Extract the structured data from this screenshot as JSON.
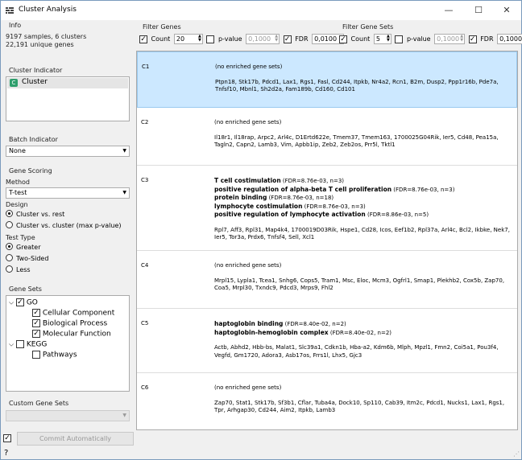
{
  "window": {
    "title": "Cluster Analysis",
    "minimize": "—",
    "maximize": "☐",
    "close": "✕"
  },
  "info": {
    "label": "Info",
    "line1": "9197 samples, 6 clusters",
    "line2": "22,191 unique genes"
  },
  "cluster_indicator": {
    "label": "Cluster Indicator",
    "item": "Cluster",
    "icon_letter": "C"
  },
  "batch_indicator": {
    "label": "Batch Indicator",
    "value": "None"
  },
  "gene_scoring": {
    "label": "Gene Scoring",
    "method_label": "Method",
    "method_value": "T-test",
    "design_label": "Design",
    "design_options": [
      "Cluster vs. rest",
      "Cluster vs. cluster (max p-value)"
    ],
    "test_type_label": "Test Type",
    "test_options": [
      "Greater",
      "Two-Sided",
      "Less"
    ]
  },
  "gene_sets": {
    "label": "Gene Sets",
    "go": "GO",
    "go_children": [
      "Cellular Component",
      "Biological Process",
      "Molecular Function"
    ],
    "kegg": "KEGG",
    "kegg_children": [
      "Pathways"
    ]
  },
  "custom_gene_sets": {
    "label": "Custom Gene Sets"
  },
  "commit": {
    "label": "Commit Automatically"
  },
  "filter_genes": {
    "label": "Filter Genes",
    "count_label": "Count",
    "count_value": "20",
    "pvalue_label": "p-value",
    "pvalue_value": "0,1000",
    "fdr_label": "FDR",
    "fdr_value": "0,0100"
  },
  "filter_gene_sets": {
    "label": "Filter Gene Sets",
    "count_label": "Count",
    "count_value": "5",
    "pvalue_label": "p-value",
    "pvalue_value": "0,1000",
    "fdr_label": "FDR",
    "fdr_value": "0,1000"
  },
  "clusters": [
    {
      "id": "C1",
      "no_enriched": "(no enriched gene sets)",
      "genes": "Ptpn18, Stk17b, Pdcd1, Lax1, Rgs1, Fasl, Cd244, Itpkb, Nr4a2, Rcn1, B2m, Dusp2, Ppp1r16b, Pde7a, Tnfsf10, Mbnl1, Sh2d2a, Fam189b, Cd160, Cd101"
    },
    {
      "id": "C2",
      "no_enriched": "(no enriched gene sets)",
      "genes": "Il18r1, Il18rap, Arpc2, Arl4c, D1Ertd622e, Tmem37, Tmem163, 1700025G04Rik, Ier5, Cd48, Pea15a, Tagln2, Capn2, Lamb3, Vim, Apbb1ip, Zeb2, Zeb2os, Prr5l, Tktl1"
    },
    {
      "id": "C3",
      "terms": [
        {
          "name": "T cell costimulation",
          "stat": " (FDR=8.76e-03, n=3)"
        },
        {
          "name": "positive regulation of alpha-beta T cell proliferation",
          "stat": " (FDR=8.76e-03, n=3)"
        },
        {
          "name": "protein binding",
          "stat": " (FDR=8.76e-03, n=18)"
        },
        {
          "name": "lymphocyte costimulation",
          "stat": " (FDR=8.76e-03, n=3)"
        },
        {
          "name": "positive regulation of lymphocyte activation",
          "stat": " (FDR=8.86e-03, n=5)"
        }
      ],
      "genes": "Rpl7, Aff3, Rpl31, Map4k4, 1700019D03Rik, Hspe1, Cd28, Icos, Eef1b2, Rpl37a, Arl4c, Bcl2, Ikbke, Nek7, Ier5, Tor3a, Prdx6, Tnfsf4, Sell, Xcl1"
    },
    {
      "id": "C4",
      "no_enriched": "(no enriched gene sets)",
      "genes": "Mrpl15, Lypla1, Tcea1, Snhg6, Cops5, Tram1, Msc, Eloc, Mcm3, Ogfrl1, Smap1, Plekhb2, Cox5b, Zap70, Coa5, Mrpl30, Txndc9, Pdcd3, Mrps9, Fhl2"
    },
    {
      "id": "C5",
      "terms": [
        {
          "name": "haptoglobin binding",
          "stat": " (FDR=8.40e-02, n=2)"
        },
        {
          "name": "haptoglobin-hemoglobin complex",
          "stat": " (FDR=8.40e-02, n=2)"
        }
      ],
      "genes": "Actb, Abhd2, Hbb-bs, Malat1, Slc39a1, Cdkn1b, Hba-a2, Kdm6b, Mlph, Mpzl1, Fmn2, Coi5a1, Pou3f4, Vegfd, Gm1720, Adora3, Asb17os, Frrs1l, Lhx5, Gjc3"
    },
    {
      "id": "C6",
      "no_enriched": "(no enriched gene sets)",
      "genes": "Zap70, Stat1, Stk17b, Sf3b1, Cflar, Tuba4a, Dock10, Sp110, Cab39, Itm2c, Pdcd1, Nucks1, Lax1, Rgs1, Tpr, Arhgap30, Cd244, Aim2, Itpkb, Lamb3"
    }
  ],
  "colors": {
    "selected_row": "#cce8ff",
    "cluster_icon": "#2e9e6c"
  }
}
